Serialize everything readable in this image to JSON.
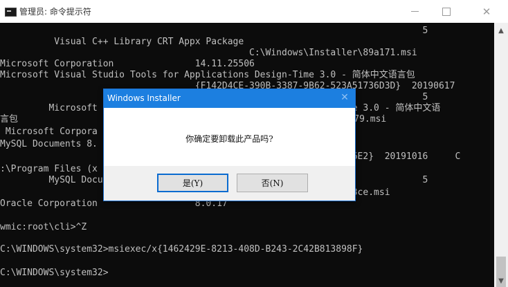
{
  "window": {
    "title": "管理员: 命令提示符",
    "minimize_glyph": "",
    "close_glyph": "✕"
  },
  "console": {
    "lines": [
      "                                                                              5",
      "          Visual C++ Library CRT Appx Package",
      "                                              C:\\Windows\\Installer\\89a171.msi",
      "Microsoft Corporation               14.11.25506",
      "Microsoft Visual Studio Tools for Applications Design-Time 3.0 - 简体中文语言包",
      "                                    {F142D4CE-390B-3387-9B62-523A51736D3D}  20190617",
      "                                                                              5",
      "         Microsoft                                          n-Time 3.0 - 简体中文语",
      "言包                                                         37f0379.msi",
      " Microsoft Corpora",
      "MySQL Documents 8.",
      "                                                             15346E2}  20191016     C",
      ":\\Program Files (x",
      "         MySQL Docu                                                           5",
      "                                                             190f3ce.msi",
      "Oracle Corporation                  8.0.17",
      "",
      "wmic:root\\cli>^Z",
      "",
      "C:\\WINDOWS\\system32>msiexec/x{1462429E-8213-408D-B243-2C42B813898F}",
      "",
      "C:\\WINDOWS\\system32>"
    ]
  },
  "dialog": {
    "title": "Windows Installer",
    "message": "你确定要卸载此产品吗?",
    "yes_label": "是(Y)",
    "no_label": "否(N)",
    "close_glyph": "✕"
  },
  "scrollbar": {
    "up_glyph": "▲",
    "down_glyph": "▼"
  },
  "colors": {
    "console_bg": "#0c0c0c",
    "console_text": "#c0c0c0",
    "dialog_accent": "#1c7fe0"
  }
}
